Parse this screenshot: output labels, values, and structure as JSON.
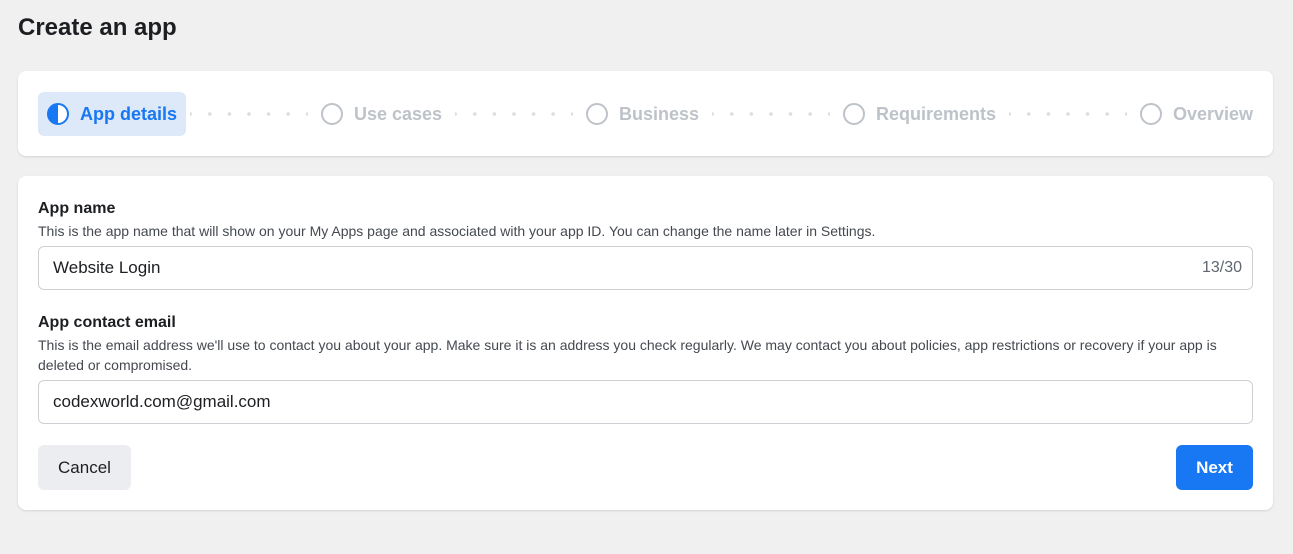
{
  "page": {
    "title": "Create an app"
  },
  "stepper": {
    "steps": [
      {
        "label": "App details",
        "state": "active",
        "icon": "half-filled-circle-icon"
      },
      {
        "label": "Use cases",
        "state": "inactive",
        "icon": "empty-circle-icon"
      },
      {
        "label": "Business",
        "state": "inactive",
        "icon": "empty-circle-icon"
      },
      {
        "label": "Requirements",
        "state": "inactive",
        "icon": "empty-circle-icon"
      },
      {
        "label": "Overview",
        "state": "inactive",
        "icon": "empty-circle-icon"
      }
    ]
  },
  "form": {
    "app_name": {
      "label": "App name",
      "description": "This is the app name that will show on your My Apps page and associated with your app ID. You can change the name later in Settings.",
      "value": "Website Login",
      "counter": "13/30"
    },
    "contact_email": {
      "label": "App contact email",
      "description": "This is the email address we'll use to contact you about your app. Make sure it is an address you check regularly. We may contact you about policies, app restrictions or recovery if your app is deleted or compromised.",
      "value": "codexworld.com@gmail.com"
    },
    "cancel_label": "Cancel",
    "next_label": "Next"
  },
  "colors": {
    "accent": "#1877f2",
    "active_step_bg": "#dde9f9",
    "inactive_step": "#bec3c9",
    "page_bg": "#f0f0f0"
  }
}
